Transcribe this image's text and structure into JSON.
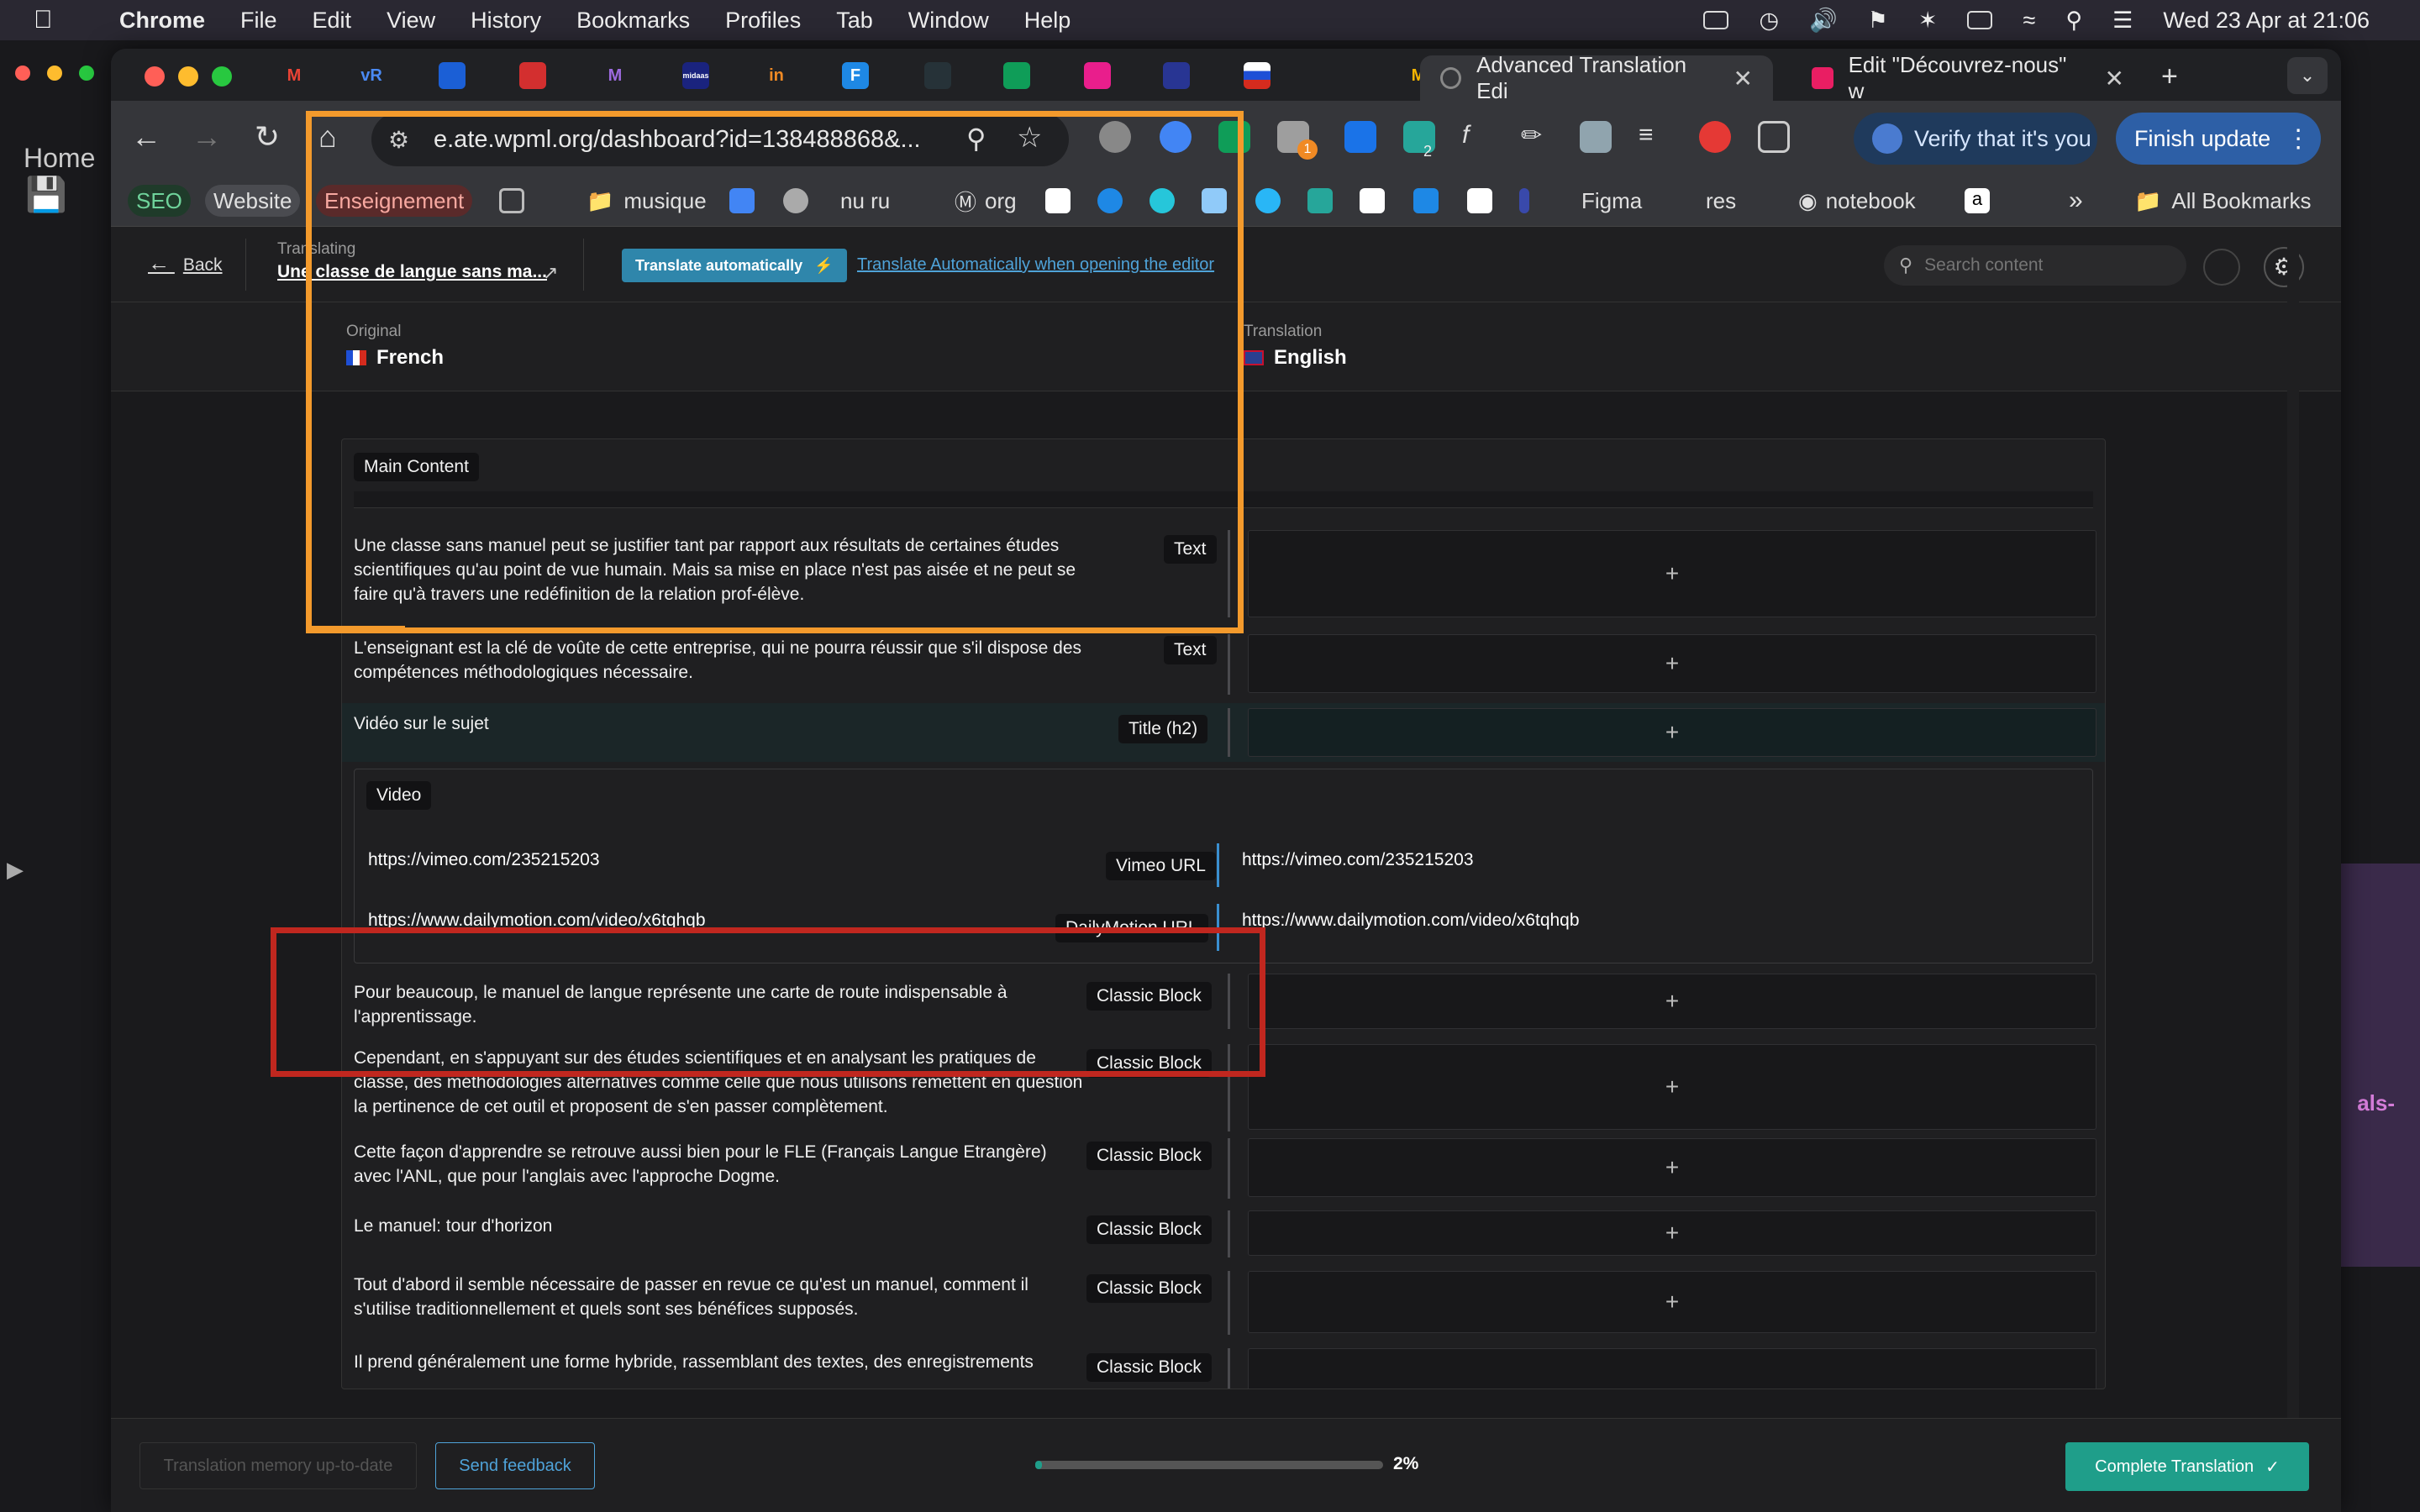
{
  "menubar": {
    "app": "Chrome",
    "items": [
      "File",
      "Edit",
      "View",
      "History",
      "Bookmarks",
      "Profiles",
      "Tab",
      "Window",
      "Help"
    ],
    "datetime": "Wed 23 Apr at  21:06"
  },
  "behind": {
    "home": "Home",
    "side_text": "als-"
  },
  "tabs": {
    "pinned": [
      "M",
      "vR",
      "",
      "",
      "M",
      "midaas",
      "in",
      "F",
      "",
      "",
      "",
      "",
      "",
      "",
      "",
      "M"
    ],
    "active_title": "Advanced Translation Edi",
    "other_title": "Edit \"Découvrez-nous\" w"
  },
  "toolbar": {
    "url": "e.ate.wpml.org/dashboard?id=138488868&...",
    "verify": "Verify that it's you",
    "finish": "Finish update",
    "ext_badges": [
      "1",
      "2"
    ]
  },
  "bookmarks": {
    "seo": "SEO",
    "website": "Website",
    "enseignement": "Enseignement",
    "items": [
      "musique",
      "nu ru",
      "org",
      "Figma",
      "res",
      "notebook"
    ],
    "all": "All Bookmarks"
  },
  "editor": {
    "back": "Back",
    "translating_label": "Translating",
    "doc_title": "Une classe de langue sans ma...",
    "translate_auto": "Translate automatically",
    "translate_auto_link": "Translate Automatically when opening the editor",
    "search_placeholder": "Search content",
    "original_label": "Original",
    "original_lang": "French",
    "translation_label": "Translation",
    "translation_lang": "English",
    "section": "Main Content",
    "video_group": "Video",
    "rows": [
      {
        "text": "Une classe sans manuel peut se justifier tant par rapport aux résultats de certaines études scientifiques qu'au point de vue humain. Mais sa mise en place n'est pas aisée et ne peut se faire qu'à travers une redéfinition de la relation prof-élève.",
        "tag": "Text"
      },
      {
        "text": "L'enseignant est la clé de voûte de cette entreprise, qui ne pourra réussir que s'il dispose des compétences méthodologiques nécessaire.",
        "tag": "Text"
      },
      {
        "text": "Vidéo sur le sujet",
        "tag": "Title (h2)"
      },
      {
        "text": "https://vimeo.com/235215203",
        "tag": "Vimeo URL",
        "translation": "https://vimeo.com/235215203"
      },
      {
        "text": "https://www.dailymotion.com/video/x6tqhqb",
        "tag": "DailyMotion URL",
        "translation": "https://www.dailymotion.com/video/x6tqhqb"
      },
      {
        "text": "Pour beaucoup, le manuel de langue représente une carte de route indispensable à l'apprentissage.",
        "tag": "Classic Block"
      },
      {
        "text": "Cependant, en s'appuyant sur des études scientifiques et en analysant les pratiques de classe, des méthodologies alternatives comme celle que nous utilisons remettent en question la pertinence de cet outil et proposent de s'en passer complètement.",
        "tag": "Classic Block"
      },
      {
        "text": "Cette façon d'apprendre se retrouve aussi bien pour le FLE (Français Langue Etrangère) avec l'ANL, que pour l'anglais avec l'approche Dogme.",
        "tag": "Classic Block"
      },
      {
        "text": "Le manuel: tour d'horizon",
        "tag": "Classic Block"
      },
      {
        "text": "Tout d'abord il semble nécessaire de passer en revue ce qu'est un manuel, comment il s'utilise traditionnellement et quels sont ses bénéfices supposés.",
        "tag": "Classic Block"
      },
      {
        "text": "Il prend généralement une forme hybride, rassemblant des textes, des enregistrements",
        "tag": "Classic Block"
      }
    ],
    "plus": "+",
    "footer": {
      "memory": "Translation memory up-to-date",
      "feedback": "Send feedback",
      "progress_value": 0.02,
      "progress_text": "2%",
      "complete": "Complete Translation"
    }
  },
  "colors": {
    "orange_highlight": "#f39a2c",
    "red_highlight": "#c0271f",
    "accent_teal": "#1f9e8a",
    "link_blue": "#4fa3d9"
  }
}
